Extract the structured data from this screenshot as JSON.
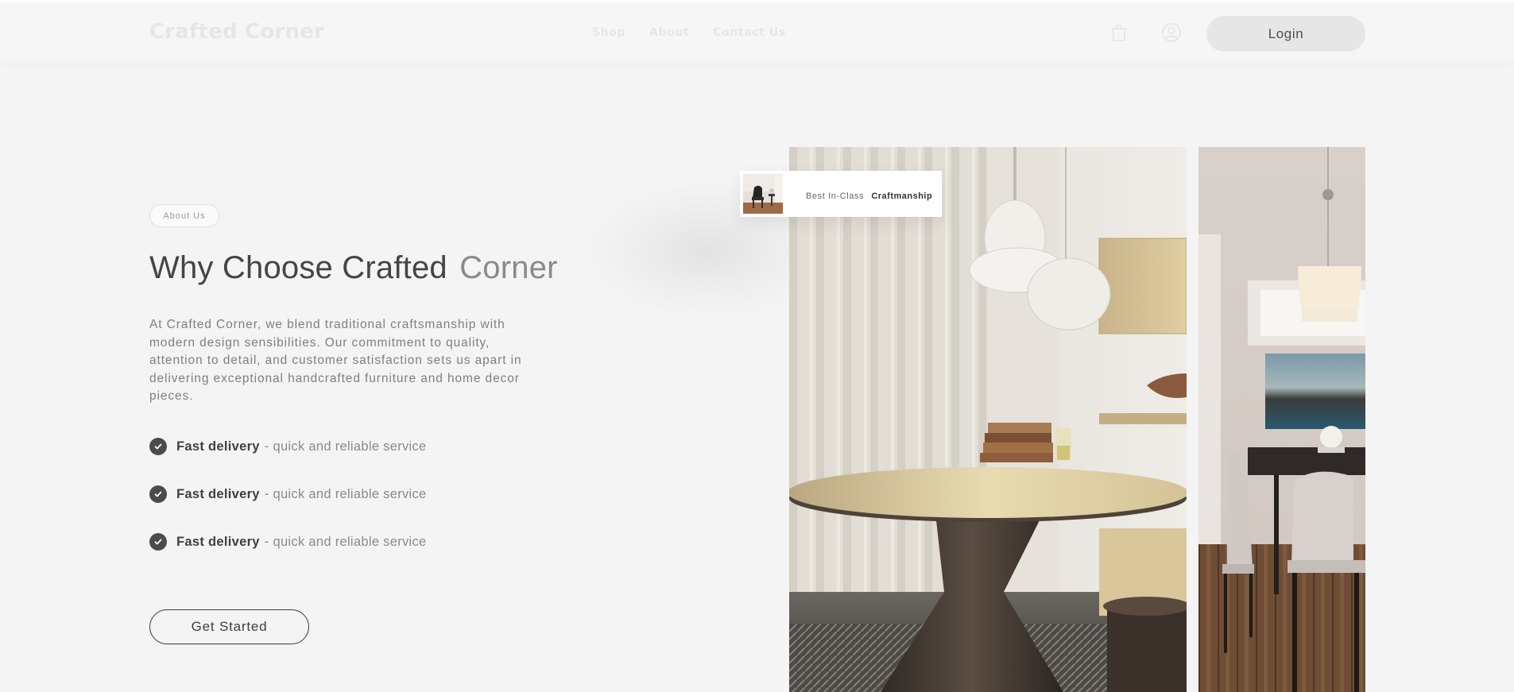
{
  "header": {
    "logo": "Crafted Corner",
    "nav": [
      "Shop",
      "About",
      "Contact Us"
    ],
    "cart_icon": "shopping-bag-icon",
    "account_icon": "user-circle-icon",
    "login_label": "Login"
  },
  "hero": {
    "tag": "About Us",
    "title_main": "Why Choose Crafted",
    "title_accent": "Corner",
    "description": "At Crafted Corner, we blend traditional craftsmanship with modern design sensibilities. Our commitment to quality, attention to detail, and customer satisfaction sets us apart in delivering exceptional handcrafted furniture and home decor pieces.",
    "features": [
      {
        "bold": "Fast delivery",
        "rest": "- quick and reliable service"
      },
      {
        "bold": "Fast delivery",
        "rest": "- quick and reliable service"
      },
      {
        "bold": "Fast delivery",
        "rest": "- quick and reliable service"
      }
    ],
    "cta_label": "Get Started"
  },
  "badge": {
    "light": "Best In-Class",
    "bold": "Craftmanship"
  },
  "colors": {
    "background": "#f4f4f4",
    "text_dark": "#454545",
    "text_muted": "#8a8a8a",
    "check": "#4b4b4b",
    "login_bg": "#e6e6e6"
  }
}
